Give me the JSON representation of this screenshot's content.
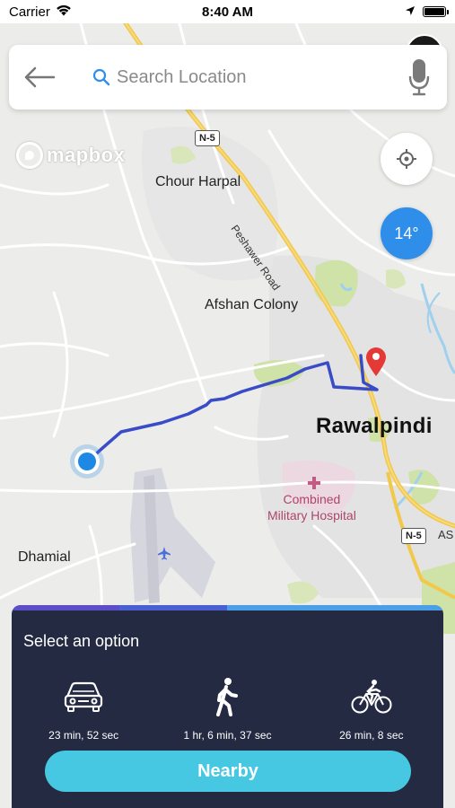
{
  "status_bar": {
    "carrier": "Carrier",
    "time": "8:40 AM",
    "battery_level": 1.0,
    "icons": [
      "wifi-icon",
      "location-arrow-icon",
      "battery-icon"
    ]
  },
  "search": {
    "placeholder": "Search Location",
    "value": ""
  },
  "map": {
    "attribution": "mapbox",
    "temperature": "14°",
    "labels": {
      "chour_harpal": "Chour Harpal",
      "afshan_colony": "Afshan Colony",
      "rawalpindi": "Rawalpindi",
      "dhamial": "Dhamial",
      "hospital_line1": "Combined",
      "hospital_line2": "Military Hospital",
      "peshawer_road": "Peshawer Road",
      "n5_top": "N-5",
      "n5_bottom": "N-5",
      "as_partial": "AS"
    },
    "colors": {
      "route": "#3a4bc8",
      "user_location": "#1e88e5",
      "destination_pin": "#e53935",
      "highway": "#f2c84b",
      "park": "#cfe2a7"
    }
  },
  "panel": {
    "title": "Select an option",
    "options": [
      {
        "icon": "car-icon",
        "time": "23 min, 52 sec"
      },
      {
        "icon": "walking-icon",
        "time": "1 hr, 6 min, 37 sec"
      },
      {
        "icon": "bicycle-icon",
        "time": "26 min, 8 sec"
      }
    ],
    "nearby_label": "Nearby",
    "colors": {
      "background": "#252a43",
      "button": "#46c8e3"
    }
  }
}
